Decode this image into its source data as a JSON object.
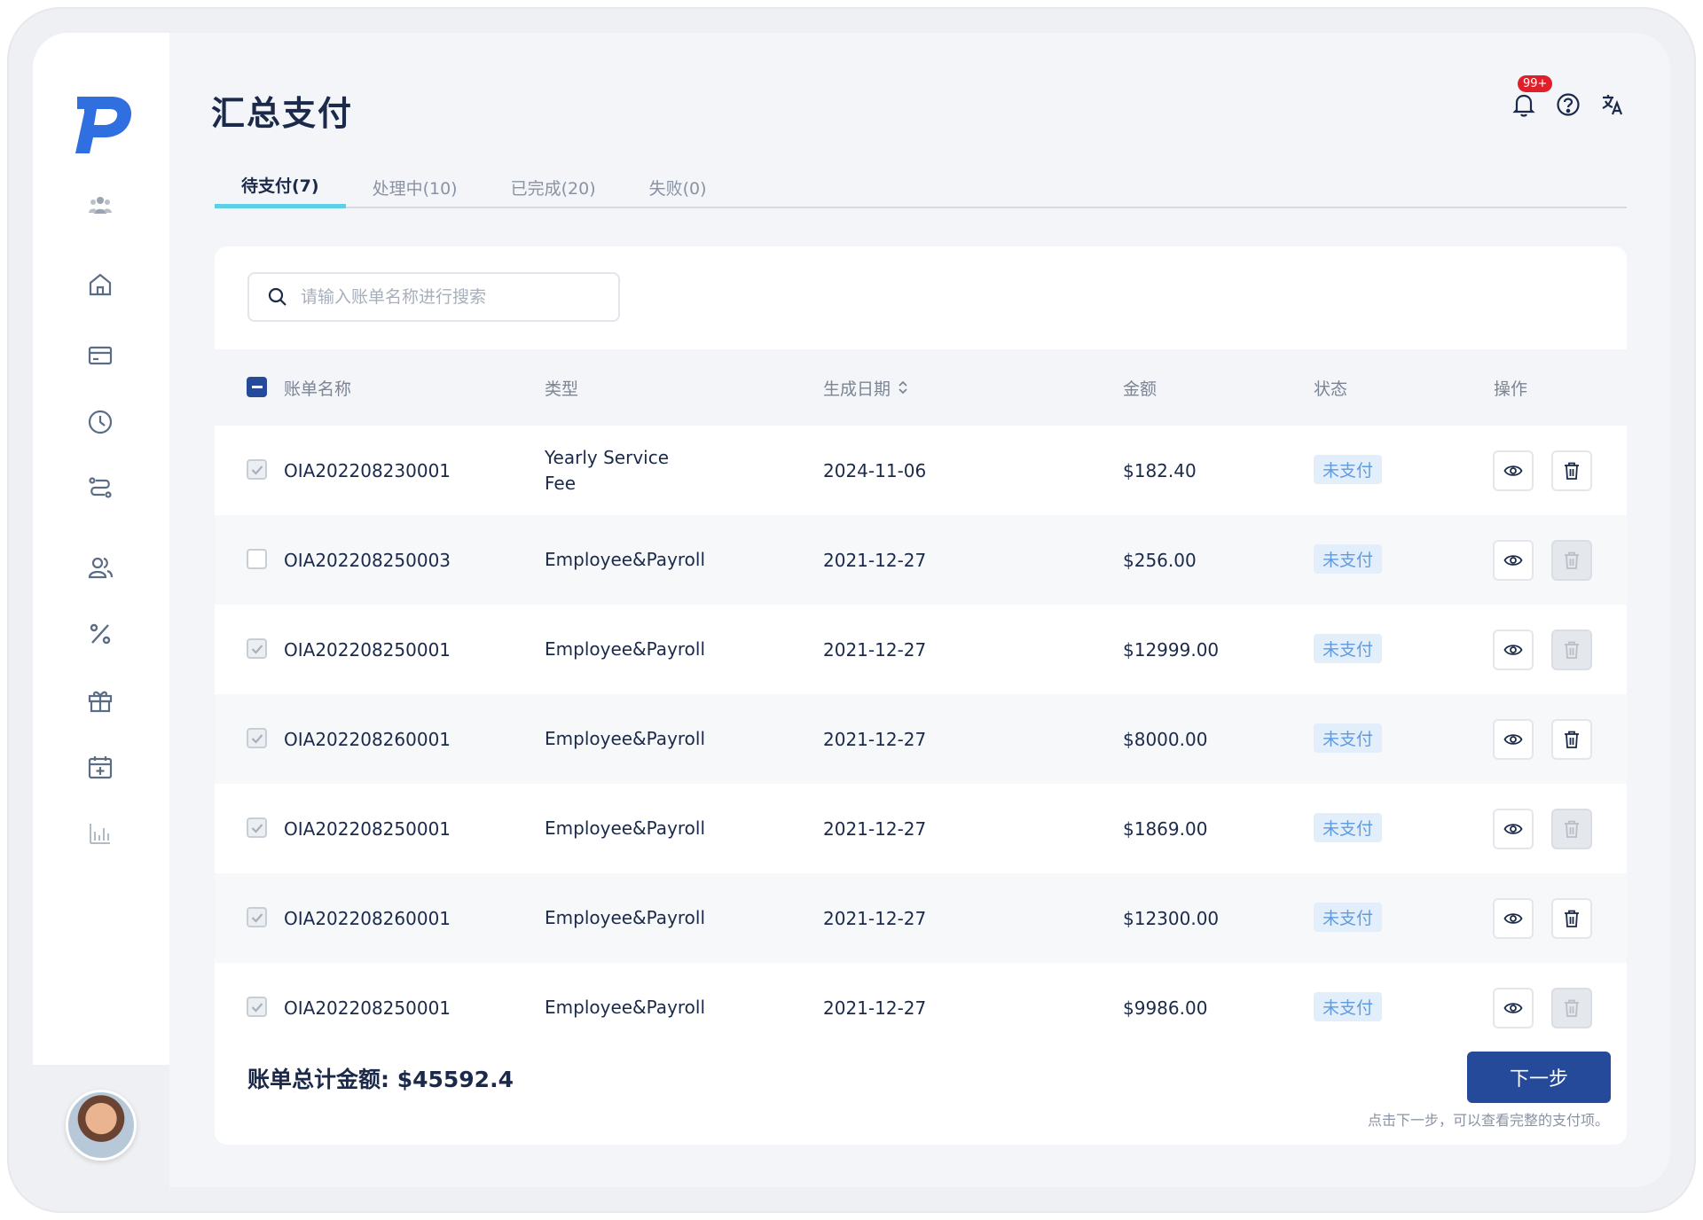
{
  "app": {
    "logo_text": "P"
  },
  "header": {
    "title": "汇总支付",
    "notification_badge": "99+"
  },
  "tabs": [
    {
      "label": "待支付(7)",
      "active": true
    },
    {
      "label": "处理中(10)",
      "active": false
    },
    {
      "label": "已完成(20)",
      "active": false
    },
    {
      "label": "失败(0)",
      "active": false
    }
  ],
  "search": {
    "placeholder": "请输入账单名称进行搜索",
    "value": ""
  },
  "table": {
    "columns": {
      "name": "账单名称",
      "type": "类型",
      "date": "生成日期",
      "amount": "金额",
      "status": "状态",
      "actions": "操作"
    },
    "rows": [
      {
        "name": "OIA202208230001",
        "type": "Yearly Service Fee",
        "date": "2024-11-06",
        "amount": "$182.40",
        "status": "未支付",
        "checked": true,
        "delete_enabled": true
      },
      {
        "name": "OIA202208250003",
        "type": "Employee&Payroll",
        "date": "2021-12-27",
        "amount": "$256.00",
        "status": "未支付",
        "checked": false,
        "delete_enabled": false
      },
      {
        "name": "OIA202208250001",
        "type": "Employee&Payroll",
        "date": "2021-12-27",
        "amount": "$12999.00",
        "status": "未支付",
        "checked": true,
        "delete_enabled": false
      },
      {
        "name": "OIA202208260001",
        "type": "Employee&Payroll",
        "date": "2021-12-27",
        "amount": "$8000.00",
        "status": "未支付",
        "checked": true,
        "delete_enabled": true
      },
      {
        "name": "OIA202208250001",
        "type": "Employee&Payroll",
        "date": "2021-12-27",
        "amount": "$1869.00",
        "status": "未支付",
        "checked": true,
        "delete_enabled": false
      },
      {
        "name": "OIA202208260001",
        "type": "Employee&Payroll",
        "date": "2021-12-27",
        "amount": "$12300.00",
        "status": "未支付",
        "checked": true,
        "delete_enabled": true
      },
      {
        "name": "OIA202208250001",
        "type": "Employee&Payroll",
        "date": "2021-12-27",
        "amount": "$9986.00",
        "status": "未支付",
        "checked": true,
        "delete_enabled": false
      }
    ]
  },
  "footer": {
    "total": "账单总计金额: $45592.4",
    "next_label": "下一步",
    "hint": "点击下一步，可以查看完整的支付项。"
  },
  "sidebar": {
    "items": [
      {
        "icon": "team-icon"
      },
      {
        "icon": "home-icon"
      },
      {
        "icon": "card-icon"
      },
      {
        "icon": "clock-icon"
      },
      {
        "icon": "route-icon"
      },
      {
        "icon": "users-icon"
      },
      {
        "icon": "percent-icon"
      },
      {
        "icon": "gift-icon"
      },
      {
        "icon": "calendar-add-icon"
      },
      {
        "icon": "bar-chart-icon"
      }
    ]
  },
  "colors": {
    "brand": "#254a9a",
    "logo": "#2f6fe0",
    "tab_underline": "#5ed0e5",
    "status_text": "#5f9be0",
    "status_bg": "#e3eefb",
    "badge": "#e01f2a"
  }
}
